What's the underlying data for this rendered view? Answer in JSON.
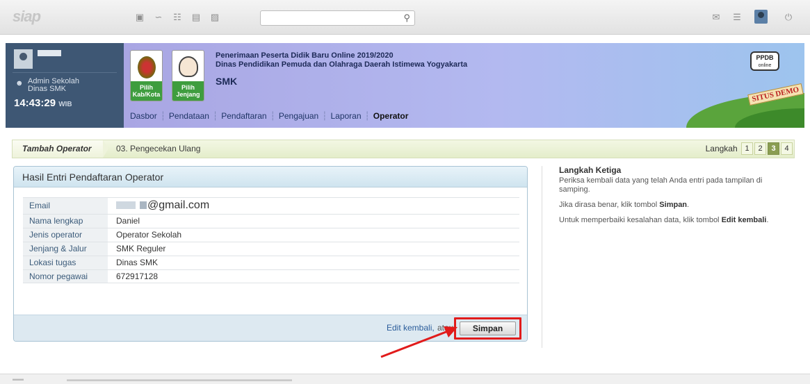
{
  "topbar": {
    "logo": "siap",
    "search_placeholder": "",
    "icons_left": [
      "cube-icon",
      "rss-icon",
      "grid-icon",
      "document-icon",
      "contacts-icon"
    ],
    "icons_right": [
      "mail-icon",
      "list-icon",
      "avatar",
      "power-icon"
    ]
  },
  "user": {
    "role_line1": "Admin Sekolah",
    "role_line2": "Dinas SMK",
    "time": "14:43:29",
    "timezone": "WIB"
  },
  "header": {
    "badge1_label_line1": "Pilih",
    "badge1_label_line2": "Kab/Kota",
    "badge2_label_line1": "Pilih",
    "badge2_label_line2": "Jenjang",
    "title_line1": "Penerimaan Peserta Didik Baru Online 2019/2020",
    "title_line2": "Dinas Pendidikan Pemuda dan Olahraga Daerah Istimewa Yogyakarta",
    "jenjang": "SMK",
    "ppdb_logo_line1": "PPDB",
    "ppdb_logo_line2": "online",
    "demo_stamp": "SITUS DEMO",
    "nav": [
      {
        "label": "Dasbor",
        "active": false
      },
      {
        "label": "Pendataan",
        "active": false
      },
      {
        "label": "Pendaftaran",
        "active": false
      },
      {
        "label": "Pengajuan",
        "active": false
      },
      {
        "label": "Laporan",
        "active": false
      },
      {
        "label": "Operator",
        "active": true
      }
    ]
  },
  "stepbar": {
    "current": "Tambah Operator",
    "step_name": "03. Pengecekan Ulang",
    "langkah_label": "Langkah",
    "pages": [
      "1",
      "2",
      "3",
      "4"
    ],
    "active_page": "3"
  },
  "panel": {
    "title": "Hasil Entri Pendaftaran Operator",
    "rows": [
      {
        "key": "Email",
        "value": "@gmail.com"
      },
      {
        "key": "Nama lengkap",
        "value": "Daniel"
      },
      {
        "key": "Jenis operator",
        "value": "Operator Sekolah"
      },
      {
        "key": "Jenjang & Jalur",
        "value": "SMK Reguler"
      },
      {
        "key": "Lokasi tugas",
        "value": "Dinas SMK"
      },
      {
        "key": "Nomor pegawai",
        "value": "672917128"
      }
    ],
    "edit_label": "Edit kembali,",
    "or_label": "atau",
    "save_label": "Simpan"
  },
  "help": {
    "title": "Langkah Ketiga",
    "p1": "Periksa kembali data yang telah Anda entri pada tampilan di samping.",
    "p2_prefix": "Jika dirasa benar, klik tombol ",
    "p2_bold": "Simpan",
    "p2_suffix": ".",
    "p3_prefix": "Untuk memperbaiki kesalahan data, klik tombol ",
    "p3_bold": "Edit kembali",
    "p3_suffix": "."
  },
  "colors": {
    "user_panel_bg": "#3e5774",
    "save_highlight": "#e11b1b",
    "arrow": "#e11b1b"
  }
}
